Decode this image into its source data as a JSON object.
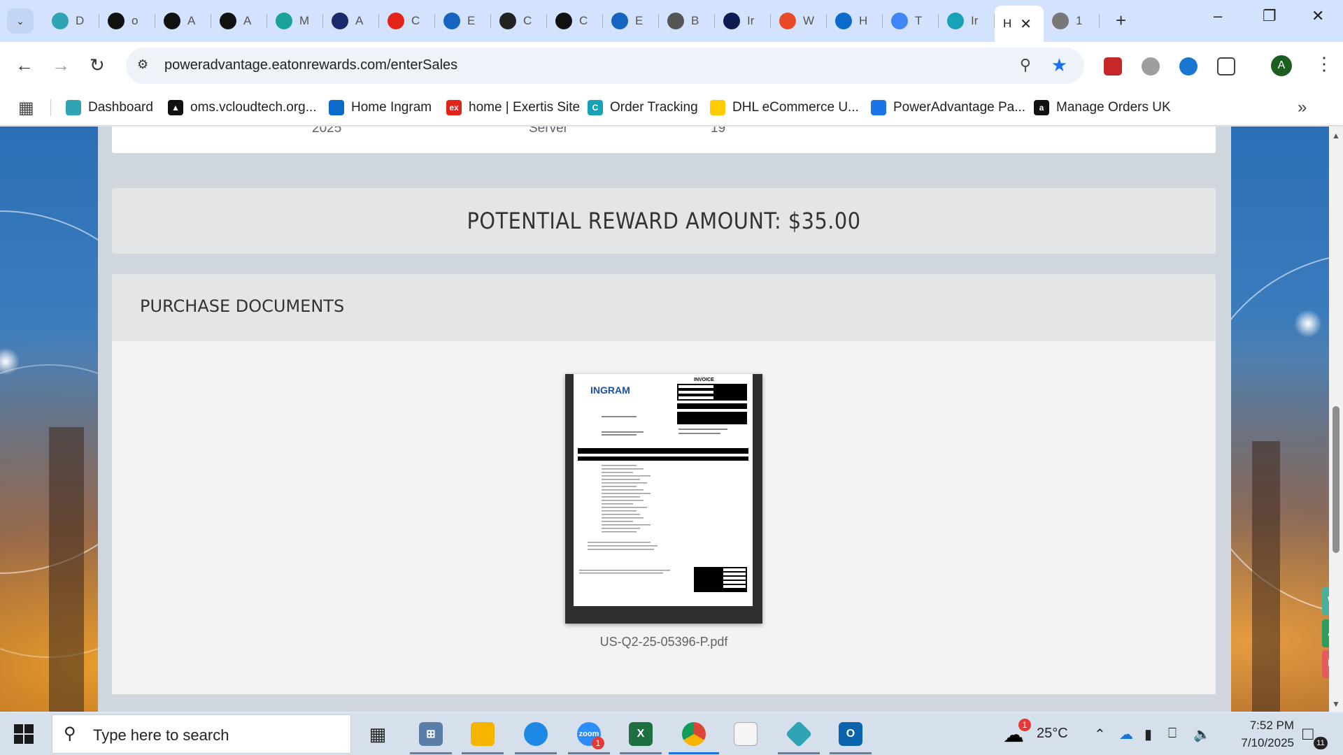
{
  "browser": {
    "tabs": [
      {
        "letter": "D",
        "icon": "hexagon-teal",
        "color": "#2fa4b5"
      },
      {
        "letter": "o",
        "icon": "triangle-black",
        "color": "#111111"
      },
      {
        "letter": "A",
        "icon": "amazon",
        "color": "#111111"
      },
      {
        "letter": "A",
        "icon": "amazon",
        "color": "#111111"
      },
      {
        "letter": "M",
        "icon": "leaf-teal",
        "color": "#1aa39a"
      },
      {
        "letter": "A",
        "icon": "arrow-navy",
        "color": "#1b2a6b"
      },
      {
        "letter": "C",
        "icon": "exertis-red",
        "color": "#e2231a"
      },
      {
        "letter": "E",
        "icon": "e-blue",
        "color": "#1565c0"
      },
      {
        "letter": "C",
        "icon": "openai",
        "color": "#222222"
      },
      {
        "letter": "C",
        "icon": "openai",
        "color": "#111111"
      },
      {
        "letter": "E",
        "icon": "e-blue",
        "color": "#1565c0"
      },
      {
        "letter": "B",
        "icon": "bulb",
        "color": "#555555"
      },
      {
        "letter": "Ir",
        "icon": "bu-navy",
        "color": "#0d1b52"
      },
      {
        "letter": "W",
        "icon": "stack-red",
        "color": "#e84a27"
      },
      {
        "letter": "H",
        "icon": "flag-blue",
        "color": "#0b6bcb"
      },
      {
        "letter": "T",
        "icon": "google",
        "color": "#4285f4"
      },
      {
        "letter": "Ir",
        "icon": "c-teal",
        "color": "#17a2b8"
      }
    ],
    "active_tab": {
      "letter": "H"
    },
    "last_tab": {
      "letter": "1",
      "icon": "globe",
      "color": "#777777"
    },
    "new_tab_label": "+",
    "url": "poweradvantage.eatonrewards.com/enterSales",
    "profile_initial": "A",
    "bookmarks": [
      {
        "label": "Dashboard",
        "icon": "hexagon-teal",
        "color": "#2fa4b5",
        "mark": ""
      },
      {
        "label": "oms.vcloudtech.org...",
        "icon": "triangle-black",
        "color": "#111111",
        "mark": "▲"
      },
      {
        "label": "Home Ingram",
        "icon": "flag-blue",
        "color": "#0b6bcb",
        "mark": ""
      },
      {
        "label": "home | Exertis Site",
        "icon": "exertis-red",
        "color": "#e2231a",
        "mark": "ex"
      },
      {
        "label": "Order Tracking",
        "icon": "c-teal",
        "color": "#17a2b8",
        "mark": "C"
      },
      {
        "label": "DHL eCommerce U...",
        "icon": "dhl",
        "color": "#ffcc00",
        "mark": ""
      },
      {
        "label": "PowerAdvantage Pa...",
        "icon": "doc-blue",
        "color": "#1a73e8",
        "mark": ""
      },
      {
        "label": "Manage Orders UK",
        "icon": "amazon",
        "color": "#111111",
        "mark": "a"
      }
    ]
  },
  "page": {
    "row_fragments": [
      "2025",
      "Server",
      "19"
    ],
    "reward_text": "POTENTIAL REWARD AMOUNT: $35.00",
    "documents_title": "PURCHASE DOCUMENTS",
    "document": {
      "filename": "US-Q2-25-05396-P.pdf",
      "logo": "INGRAM",
      "heading": "INVOICE"
    },
    "side_widgets": [
      {
        "letter": "W",
        "color": "#4caf9a"
      },
      {
        "letter": "Ac",
        "color": "#2e9d5b"
      },
      {
        "letter": "In",
        "color": "#e35b5b"
      }
    ]
  },
  "taskbar": {
    "search_placeholder": "Type here to search",
    "zoom_badge": "1",
    "temperature": "25°C",
    "weather_badge": "1",
    "time": "7:52 PM",
    "date": "7/10/2025",
    "notification_count": "11"
  }
}
